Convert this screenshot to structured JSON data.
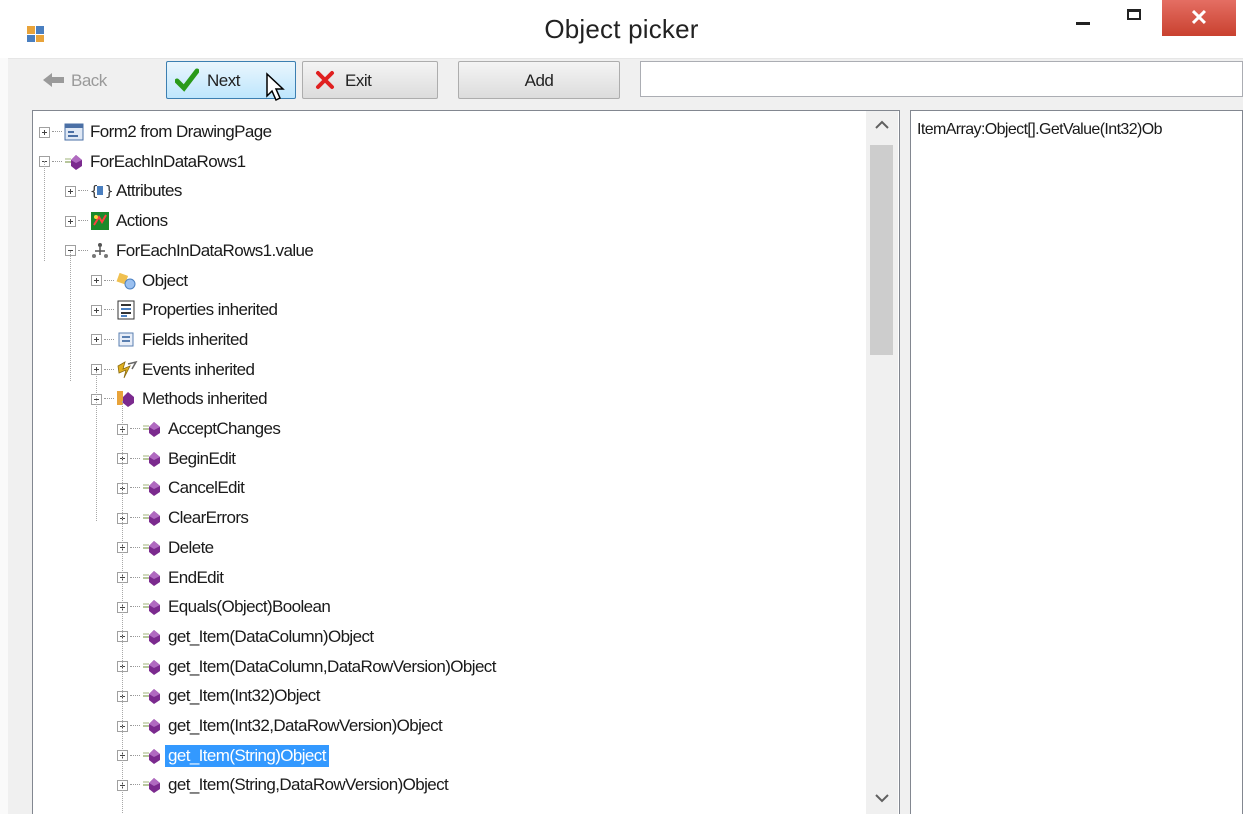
{
  "window": {
    "title": "Object picker",
    "close_glyph": "✕"
  },
  "toolbar": {
    "back_label": "Back",
    "next_label": "Next",
    "exit_label": "Exit",
    "add_label": "Add",
    "search_value": ""
  },
  "tree": [
    {
      "label": "Form2 from DrawingPage",
      "level": 0,
      "expander": "plus",
      "icon": "form-icon"
    },
    {
      "label": "ForEachInDataRows1",
      "level": 0,
      "expander": "minus",
      "icon": "purple-method-icon"
    },
    {
      "label": "Attributes",
      "level": 1,
      "expander": "plus",
      "icon": "attributes-icon"
    },
    {
      "label": "Actions",
      "level": 1,
      "expander": "plus",
      "icon": "actions-icon"
    },
    {
      "label": "ForEachInDataRows1.value",
      "level": 1,
      "expander": "minus",
      "icon": "value-icon"
    },
    {
      "label": "Object",
      "level": 2,
      "expander": "plus",
      "icon": "object-icon"
    },
    {
      "label": "Properties inherited",
      "level": 2,
      "expander": "plus",
      "icon": "properties-icon"
    },
    {
      "label": "Fields inherited",
      "level": 2,
      "expander": "plus",
      "icon": "fields-icon"
    },
    {
      "label": "Events inherited",
      "level": 2,
      "expander": "plus",
      "icon": "events-icon"
    },
    {
      "label": "Methods inherited",
      "level": 2,
      "expander": "minus",
      "icon": "methods-icon"
    },
    {
      "label": "AcceptChanges",
      "level": 3,
      "expander": "plus",
      "icon": "purple-method-icon"
    },
    {
      "label": "BeginEdit",
      "level": 3,
      "expander": "plus",
      "icon": "purple-method-icon"
    },
    {
      "label": "CancelEdit",
      "level": 3,
      "expander": "plus",
      "icon": "purple-method-icon"
    },
    {
      "label": "ClearErrors",
      "level": 3,
      "expander": "plus",
      "icon": "purple-method-icon"
    },
    {
      "label": "Delete",
      "level": 3,
      "expander": "plus",
      "icon": "purple-method-icon"
    },
    {
      "label": "EndEdit",
      "level": 3,
      "expander": "plus",
      "icon": "purple-method-icon"
    },
    {
      "label": "Equals(Object)Boolean",
      "level": 3,
      "expander": "plus",
      "icon": "purple-method-icon"
    },
    {
      "label": "get_Item(DataColumn)Object",
      "level": 3,
      "expander": "plus",
      "icon": "purple-method-icon"
    },
    {
      "label": "get_Item(DataColumn,DataRowVersion)Object",
      "level": 3,
      "expander": "plus",
      "icon": "purple-method-icon"
    },
    {
      "label": "get_Item(Int32)Object",
      "level": 3,
      "expander": "plus",
      "icon": "purple-method-icon"
    },
    {
      "label": "get_Item(Int32,DataRowVersion)Object",
      "level": 3,
      "expander": "plus",
      "icon": "purple-method-icon"
    },
    {
      "label": "get_Item(String)Object",
      "level": 3,
      "expander": "plus",
      "icon": "purple-method-icon",
      "selected": true
    },
    {
      "label": "get_Item(String,DataRowVersion)Object",
      "level": 3,
      "expander": "plus",
      "icon": "purple-method-icon"
    }
  ],
  "right_panel": {
    "text": "ItemArray:Object[].GetValue(Int32)Ob"
  },
  "colors": {
    "selection": "#3399ff",
    "close": "#d9534f",
    "method_purple": "#7b2a8e"
  }
}
